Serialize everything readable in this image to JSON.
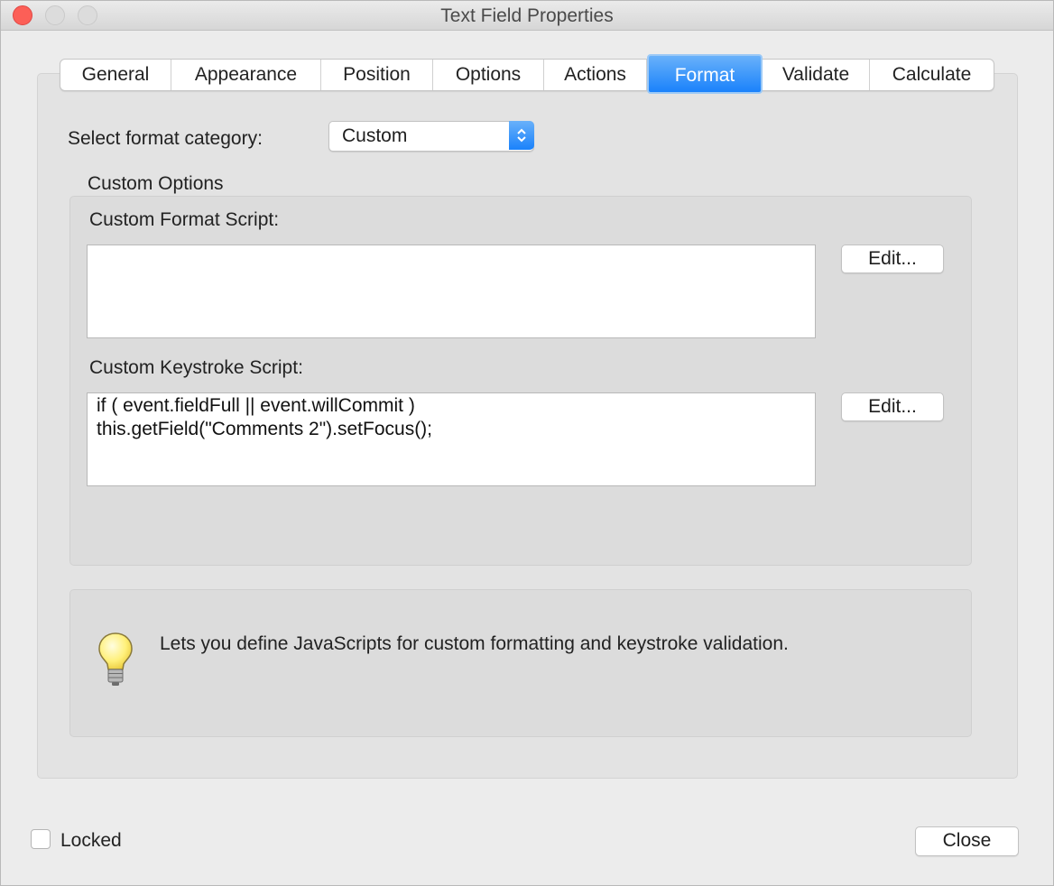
{
  "window": {
    "title": "Text Field Properties"
  },
  "tabs": [
    {
      "label": "General",
      "active": false
    },
    {
      "label": "Appearance",
      "active": false
    },
    {
      "label": "Position",
      "active": false
    },
    {
      "label": "Options",
      "active": false
    },
    {
      "label": "Actions",
      "active": false
    },
    {
      "label": "Format",
      "active": true
    },
    {
      "label": "Validate",
      "active": false
    },
    {
      "label": "Calculate",
      "active": false
    }
  ],
  "format": {
    "category_label": "Select format category:",
    "category_value": "Custom",
    "custom_options_label": "Custom Options",
    "format_script_label": "Custom Format Script:",
    "format_script_value": "",
    "keystroke_script_label": "Custom Keystroke Script:",
    "keystroke_script_line1": "if ( event.fieldFull || event.willCommit )",
    "keystroke_script_line2": "this.getField(\"Comments 2\").setFocus();",
    "edit_label": "Edit...",
    "hint_text": "Lets you define JavaScripts for custom formatting and keystroke validation.",
    "hint_icon": "lightbulb-icon"
  },
  "footer": {
    "locked_label": "Locked",
    "locked_checked": false,
    "close_label": "Close"
  },
  "colors": {
    "accent": "#1a82fb",
    "panel": "#e3e3e3"
  }
}
